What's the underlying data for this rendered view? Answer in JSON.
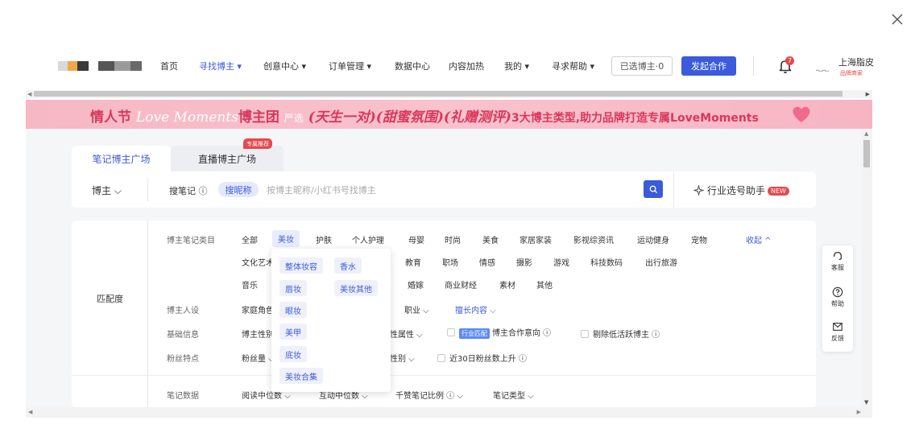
{
  "nav": {
    "items": [
      {
        "label": "首页",
        "active": false
      },
      {
        "label": "寻找博主 ▾",
        "active": true
      },
      {
        "label": "创意中心 ▾",
        "active": false
      },
      {
        "label": "订单管理 ▾",
        "active": false
      },
      {
        "label": "数据中心",
        "active": false
      },
      {
        "label": "内容加热",
        "active": false
      },
      {
        "label": "我的 ▾",
        "active": false
      },
      {
        "label": "寻求帮助 ▾",
        "active": false
      }
    ],
    "selected_btn": "已选博主·0",
    "primary_btn": "发起合作",
    "bell_count": "7",
    "user_name": "上海脂皮",
    "user_tag": "品牌商家",
    "icons": {
      "bell": "bell-icon",
      "close": "close-icon"
    }
  },
  "banner": {
    "part1": "情人节",
    "script": "Love Moments",
    "part2": "博主团",
    "sub": "严选",
    "emph": "(天生一对)(甜蜜氛围)(礼赠测评)",
    "tail": "3大博主类型,助力品牌打造专属LoveMoments"
  },
  "tabs": {
    "active": "笔记博主广场",
    "other": "直播博主广场",
    "badge": "专属推荐"
  },
  "search": {
    "type": "博主 ⌵",
    "label": "搜笔记 ⓘ",
    "pill": "搜昵称",
    "placeholder": "按博主昵称/小红书号找博主",
    "assistant": "行业选号助手",
    "new": "NEW"
  },
  "filters": {
    "match_label": "匹配度",
    "row1_label": "博主笔记类目",
    "row1": [
      "全部",
      "美妆",
      "护肤",
      "个人护理",
      "母婴",
      "时尚",
      "美食",
      "家居家装",
      "影视综资讯",
      "运动健身",
      "宠物"
    ],
    "collapse": "收起 ^",
    "row2": [
      "文化艺术",
      "教育",
      "职场",
      "情感",
      "摄影",
      "游戏",
      "科技数码",
      "出行旅游"
    ],
    "row3": [
      "音乐",
      "婚嫁",
      "商业财经",
      "素材",
      "其他"
    ],
    "persona_label": "博主人设",
    "persona": [
      "家庭角色 ⌵",
      "职业 ⌵",
      "擅长内容 ⌵"
    ],
    "basic_label": "基础信息",
    "basic": [
      "博主性别 ⌵",
      "性属性 ⌵"
    ],
    "industry_tag": "行业匹配",
    "coop_intent": "博主合作意向 ⓘ",
    "exclude_low": "剔除低活跃博主 ⓘ",
    "fans_label": "粉丝特点",
    "fans": [
      "粉丝量 ⌵",
      "性别 ⌵"
    ],
    "fans_up": "近30日粉丝数上升 ⓘ",
    "note_label": "笔记数据",
    "note": [
      "阅读中位数 ⌵",
      "互动中位数 ⌵",
      "千赞笔记比例 ⓘ ⌵",
      "笔记类型 ⌵"
    ]
  },
  "dropdown": [
    "整体妆容",
    "香水",
    "唇妆",
    "美妆其他",
    "眼妆",
    "美甲",
    "底妆",
    "美妆合集"
  ],
  "side_tools": [
    {
      "label": "客服",
      "icon": "headset-icon"
    },
    {
      "label": "帮助",
      "icon": "question-icon"
    },
    {
      "label": "反馈",
      "icon": "feedback-icon"
    }
  ]
}
